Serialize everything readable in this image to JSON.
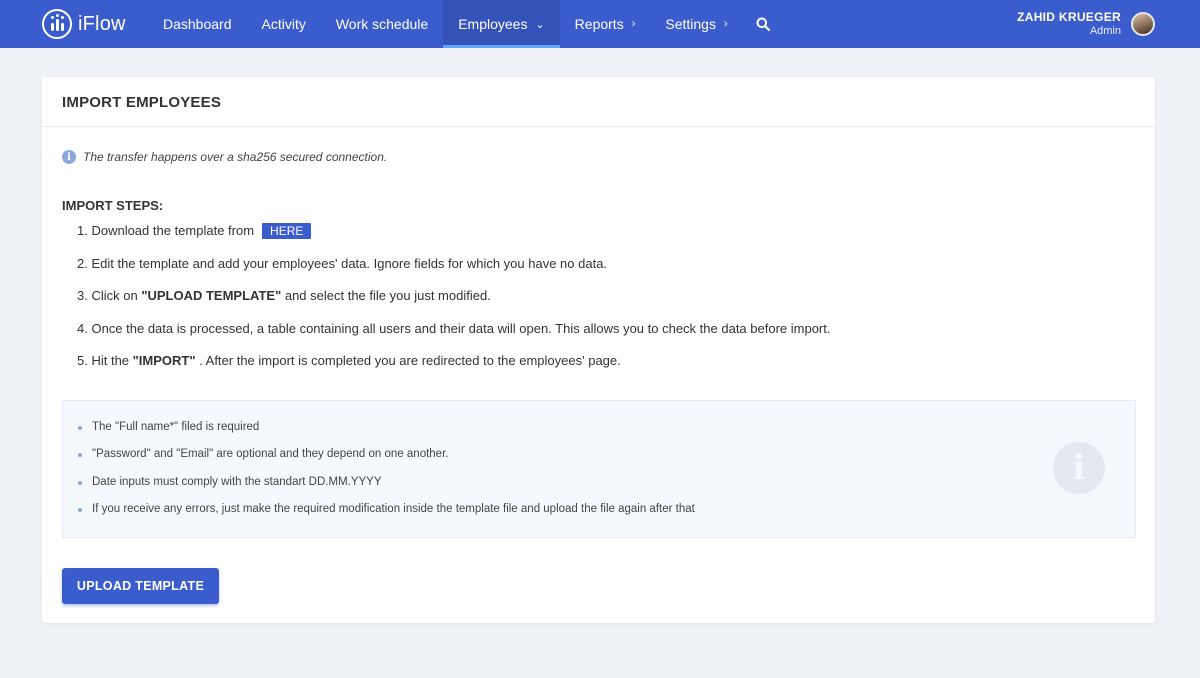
{
  "app": {
    "name": "iFlow"
  },
  "nav": {
    "items": [
      {
        "label": "Dashboard"
      },
      {
        "label": "Activity"
      },
      {
        "label": "Work schedule"
      },
      {
        "label": "Employees",
        "active": true,
        "chevron": "down"
      },
      {
        "label": "Reports",
        "chevron": "right"
      },
      {
        "label": "Settings",
        "chevron": "right"
      }
    ],
    "search_icon": "search-icon"
  },
  "user": {
    "name": "ZAHID KRUEGER",
    "role": "Admin"
  },
  "page": {
    "title": "IMPORT EMPLOYEES",
    "secure_note": "The transfer happens over a sha256 secured connection.",
    "steps_title": "IMPORT STEPS:",
    "steps": {
      "s1": {
        "text": "1. Download the template from",
        "button": "HERE"
      },
      "s2": {
        "text": "2. Edit the template and add your employees' data. Ignore fields for which you have no data."
      },
      "s3": {
        "pre": "3. Click on ",
        "bold": "\"UPLOAD TEMPLATE\"",
        "post": " and select the file you just modified."
      },
      "s4": {
        "text": "4. Once the data is processed, a table containing all users and their data will open. This allows you to check the data before import."
      },
      "s5": {
        "pre": "5. Hit the ",
        "bold": "\"IMPORT\"",
        "post": " . After the import is completed you are redirected to the employees' page."
      }
    },
    "notes": [
      "The \"Full name*\" filed is required",
      "\"Password\" and \"Email\" are optional and they depend on one another.",
      "Date inputs must comply with the standart DD.MM.YYYY",
      "If you receive any errors, just make the required modification inside the template file and upload the file again after that"
    ],
    "upload_button": "UPLOAD TEMPLATE"
  },
  "colors": {
    "primary": "#3a5ccc",
    "background": "#eef1f6",
    "accent": "#5fa5ff"
  }
}
